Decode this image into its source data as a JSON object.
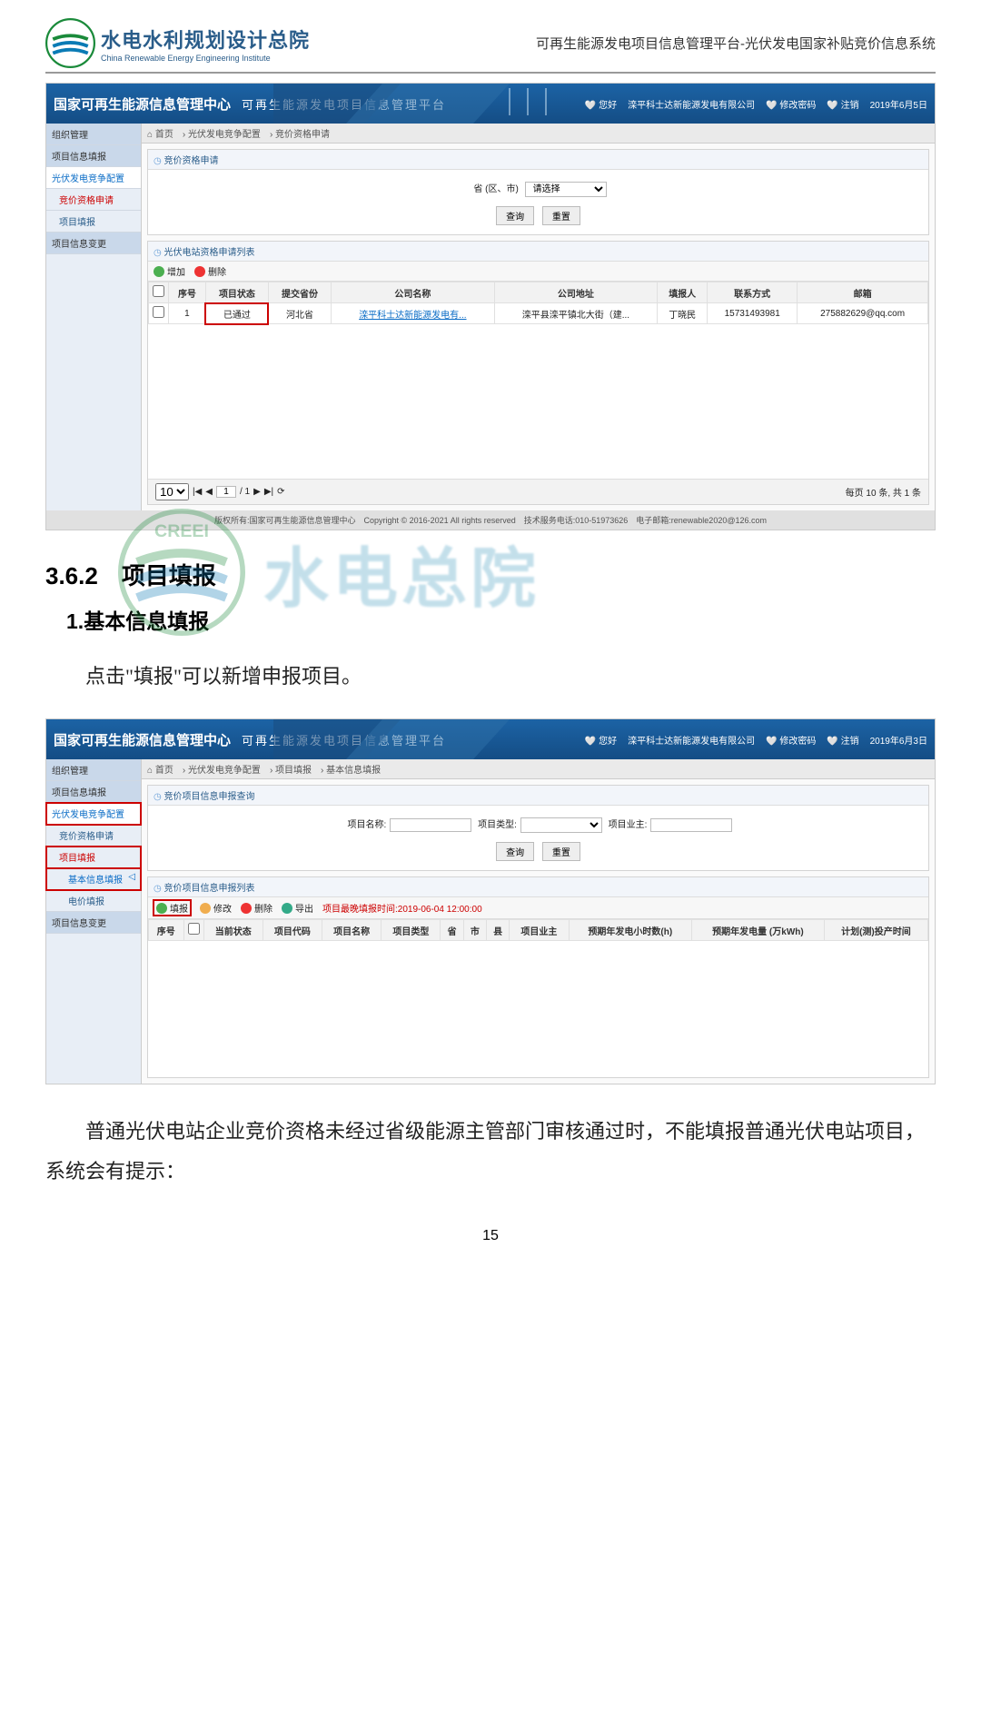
{
  "doc_header": {
    "org_cn": "水电水利规划设计总院",
    "org_en": "China Renewable Energy Engineering Institute",
    "title": "可再生能源发电项目信息管理平台-光伏发电国家补贴竞价信息系统"
  },
  "section_no": "3.6.2",
  "section_title": "项目填报",
  "sub1_no": "1.",
  "sub1_title": "基本信息填报",
  "body_line1": "点击\"填报\"可以新增申报项目。",
  "body_para2": "普通光伏电站企业竞价资格未经过省级能源主管部门审核通过时，不能填报普通光伏电站项目，系统会有提示：",
  "watermark": {
    "text": "水电总院",
    "logo": "CREEI"
  },
  "shot1": {
    "header": {
      "title": "国家可再生能源信息管理中心",
      "platform": "可再生能源发电项目信息管理平台",
      "greet": "您好",
      "company": "滦平科士达新能源发电有限公司",
      "chpwd": "修改密码",
      "logout": "注销",
      "date": "2019年6月5日"
    },
    "sidebar": [
      "组织管理",
      "项目信息填报",
      "光伏发电竞争配置",
      "竞价资格申请",
      "项目填报",
      "项目信息变更"
    ],
    "crumbs": [
      "首页",
      "光伏发电竞争配置",
      "竞价资格申请"
    ],
    "panel1_title": "竞价资格申请",
    "filter_label": "省 (区、市)",
    "filter_placeholder": "请选择",
    "btn_query": "查询",
    "btn_reset": "重置",
    "panel2_title": "光伏电站资格申请列表",
    "tb_add": "增加",
    "tb_del": "删除",
    "cols": [
      "",
      "序号",
      "项目状态",
      "提交省份",
      "公司名称",
      "公司地址",
      "填报人",
      "联系方式",
      "邮箱"
    ],
    "row": {
      "idx": "1",
      "status": "已通过",
      "prov": "河北省",
      "company": "滦平科士达新能源发电有...",
      "addr": "滦平县滦平镇北大街（建...",
      "person": "丁晓民",
      "phone": "15731493981",
      "email": "275882629@qq.com"
    },
    "pager": {
      "size": "10",
      "page": "1",
      "total": "/ 1",
      "info": "每页 10 条, 共 1 条"
    },
    "footer": "版权所有:国家可再生能源信息管理中心　Copyright © 2016-2021 All rights reserved　技术服务电话:010-51973626　电子邮箱:renewable2020@126.com"
  },
  "shot2": {
    "header": {
      "title": "国家可再生能源信息管理中心",
      "platform": "可再生能源发电项目信息管理平台",
      "greet": "您好",
      "company": "滦平科士达新能源发电有限公司",
      "chpwd": "修改密码",
      "logout": "注销",
      "date": "2019年6月3日"
    },
    "sidebar": [
      "组织管理",
      "项目信息填报",
      "光伏发电竞争配置",
      "竞价资格申请",
      "项目填报",
      "基本信息填报",
      "电价填报",
      "项目信息变更"
    ],
    "crumbs": [
      "首页",
      "光伏发电竞争配置",
      "项目填报",
      "基本信息填报"
    ],
    "panel1_title": "竞价项目信息申报查询",
    "f_name": "项目名称:",
    "f_type": "项目类型:",
    "f_owner": "项目业主:",
    "btn_query": "查询",
    "btn_reset": "重置",
    "panel2_title": "竞价项目信息申报列表",
    "tb_fill": "填报",
    "tb_mod": "修改",
    "tb_del": "删除",
    "tb_exp": "导出",
    "deadline": "项目最晚填报时间:2019-06-04 12:00:00",
    "cols": [
      "序号",
      "",
      "当前状态",
      "项目代码",
      "项目名称",
      "项目类型",
      "省",
      "市",
      "县",
      "项目业主",
      "预期年发电小时数(h)",
      "预期年发电量 (万kWh)",
      "计划(测)投产时间"
    ]
  },
  "page_number": "15"
}
